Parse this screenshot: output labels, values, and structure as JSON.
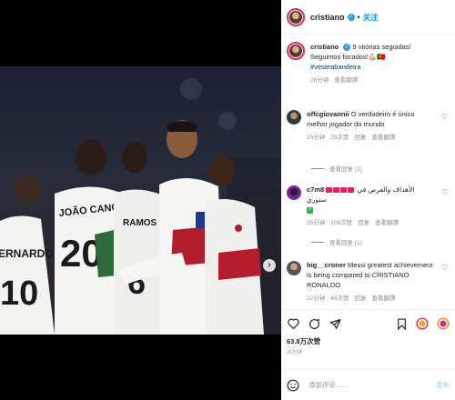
{
  "post": {
    "username": "cristiano",
    "follow_label": "关注",
    "caption": "9 vitórias seguidas!",
    "caption_line2": "Seguimos focados!💪🏼🇵🇹",
    "hashtag": "#vesteabandeira",
    "caption_time": "26分钟",
    "caption_translate": "查看翻譯"
  },
  "photo": {
    "jersey_numbers": [
      "10",
      "20",
      "6"
    ],
    "jersey_names": [
      "ERNARDO",
      "JOÃO CANCELO",
      "RAMOS"
    ],
    "next_icon": "chevron-right-icon"
  },
  "comments": [
    {
      "username": "offcgiovannii",
      "text": "O verdadeiro é único melhor jogador do mundo",
      "time": "15分钟",
      "likes": "25次赞",
      "reply": "回复",
      "translate": "查看翻譯",
      "view_replies": "查看回复 (2)"
    },
    {
      "username": "c7m8",
      "text": "الأهداف والفرص في ستوري",
      "time": "25分钟",
      "likes": "106次赞",
      "reply": "回复",
      "translate": "查看翻譯",
      "view_replies": "查看回复 (1)"
    },
    {
      "username": "big__croner",
      "text": "Messi greatest achievement is being compared to CRISTIANO RONALDO",
      "time": "22分钟",
      "likes": "48次赞",
      "reply": "回复",
      "translate": "查看翻譯"
    }
  ],
  "actions": {
    "likes_count": "63.8万次赞",
    "date": "26分钟"
  },
  "add_comment": {
    "placeholder": "添加评论……",
    "post_label": "发布"
  },
  "colors": {
    "link": "#0095f6",
    "hashtag": "#00376b",
    "muted": "#8e8e8e",
    "story_ring": "#e1306c"
  }
}
